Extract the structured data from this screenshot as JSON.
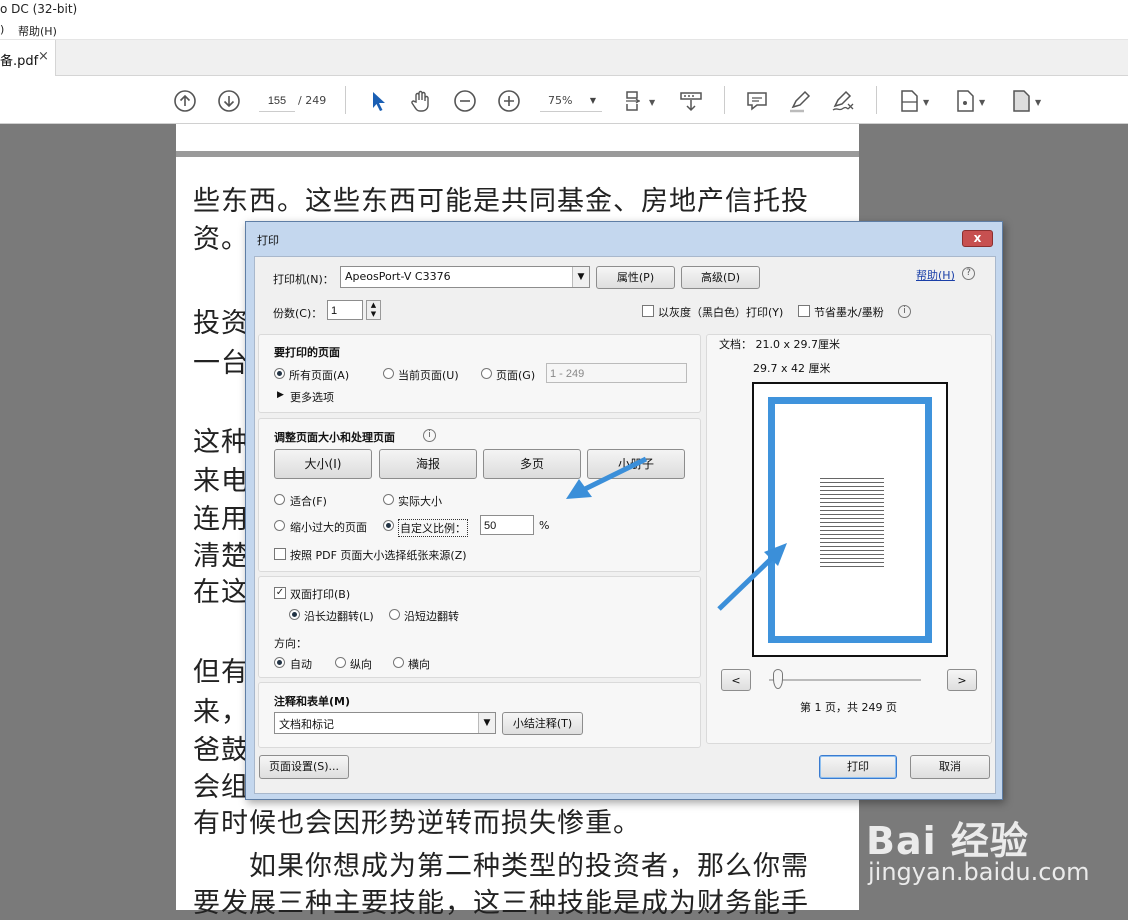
{
  "app": {
    "title": "o DC (32-bit)"
  },
  "menu": {
    "help": "帮助(H)",
    "prev": ")"
  },
  "tab": {
    "label": "备.pdf",
    "close": "×"
  },
  "toolbar": {
    "page_current": "155",
    "page_total": "/ 249",
    "zoom": "75%"
  },
  "document": {
    "lines": [
      "些东西。这些东西可能是共同基金、房地产信托投",
      "资。",
      "投资",
      "一台",
      "这种",
      "来电",
      "连用",
      "清楚",
      "在这",
      "但有",
      "来，",
      "爸鼓",
      "会组",
      "有时候也会因形势逆转而损失惨重。",
      "　　如果你想成为第二种类型的投资者，那么你需",
      "要发展三种主要技能，这三种技能是成为财务能手"
    ]
  },
  "dialog": {
    "title": "打印",
    "close": "x",
    "printer_label": "打印机(N)：",
    "printer_value": "ApeosPort-V C3376",
    "properties": "属性(P)",
    "advanced": "高级(D)",
    "help": "帮助(H)",
    "help_icon": "?",
    "copies_label": "份数(C)：",
    "copies_value": "1",
    "grayscale": "以灰度（黑白色）打印(Y)",
    "save_ink": "节省墨水/墨粉",
    "pages_section": {
      "title": "要打印的页面",
      "all": "所有页面(A)",
      "current": "当前页面(U)",
      "pages": "页面(G)",
      "range": "1 - 249",
      "more": "更多选项"
    },
    "sizing_section": {
      "title": "调整页面大小和处理页面",
      "size": "大小(I)",
      "poster": "海报",
      "multiple": "多页",
      "booklet": "小册子",
      "fit": "适合(F)",
      "actual": "实际大小",
      "shrink": "缩小过大的页面",
      "custom": "自定义比例：",
      "custom_value": "50",
      "percent": "%",
      "paper_source": "按照 PDF 页面大小选择纸张来源(Z)"
    },
    "duplex_section": {
      "duplex": "双面打印(B)",
      "long_edge": "沿长边翻转(L)",
      "short_edge": "沿短边翻转",
      "orientation_label": "方向：",
      "auto": "自动",
      "portrait": "纵向",
      "landscape": "横向"
    },
    "comments_section": {
      "title": "注释和表单(M)",
      "value": "文档和标记",
      "summarize": "小结注释(T)"
    },
    "preview": {
      "doc_size": "文档： 21.0 x 29.7厘米",
      "paper_size": "29.7 x 42 厘米",
      "prev": "<",
      "next": ">",
      "page_info": "第 1 页，共 249 页"
    },
    "page_setup": "页面设置(S)...",
    "print": "打印",
    "cancel": "取消"
  },
  "watermark": {
    "brand": "Bai 经验",
    "url": "jingyan.baidu.com"
  },
  "colors": {
    "arrow": "#3b8fd9",
    "preview_border": "#3f93dc"
  }
}
